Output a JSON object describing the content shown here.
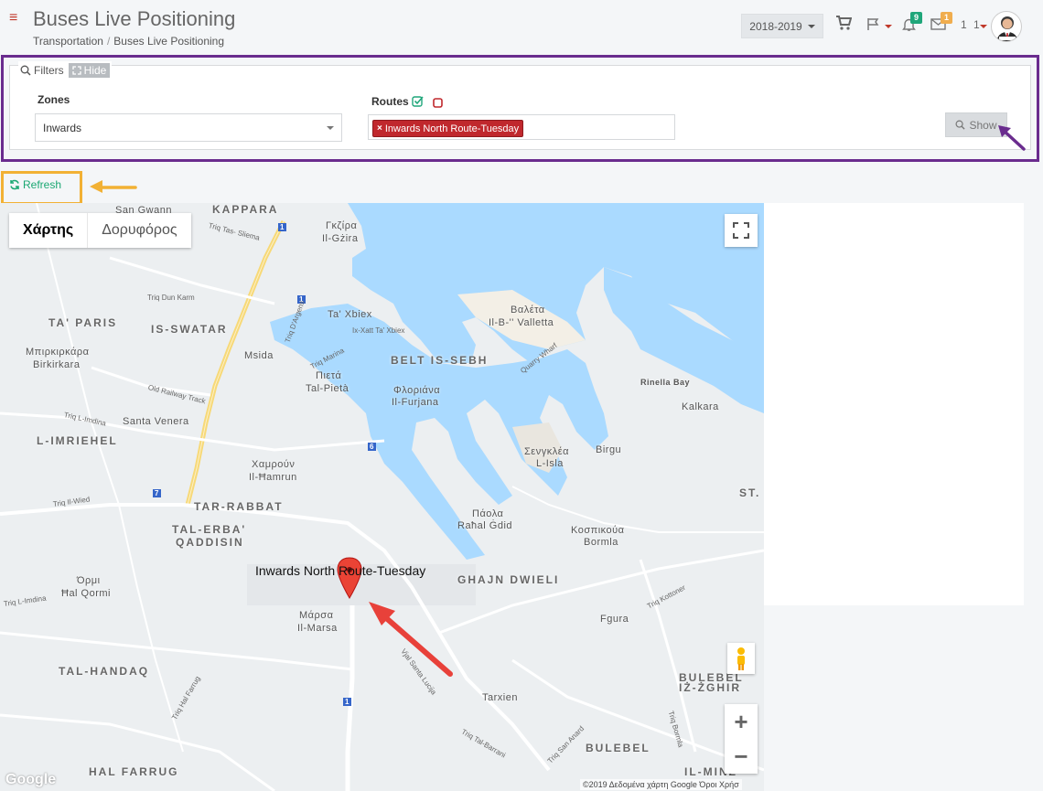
{
  "header": {
    "title": "Buses Live Positioning",
    "breadcrumb": [
      "Transportation",
      "Buses Live Positioning"
    ],
    "year_select": "2018-2019",
    "notifications_count": "9",
    "messages_count": "1",
    "user_count": "1 1",
    "colors": {
      "notif_badge": "#1fa67a",
      "msg_badge": "#f0ad4e",
      "accent": "#c0392b"
    }
  },
  "filters": {
    "legend": "Filters",
    "hide_label": "Hide",
    "zones_label": "Zones",
    "zones_value": "Inwards",
    "routes_label": "Routes",
    "route_tags": [
      "Inwards North Route-Tuesday"
    ],
    "show_label": "Show"
  },
  "refresh": {
    "label": "Refresh"
  },
  "map": {
    "map_type_options": [
      "Χάρτης",
      "Δορυφόρος"
    ],
    "selected_map_type": "Χάρτης",
    "marker_label": "Inwards North Route-Tuesday",
    "attribution": "©2019 Δεδομένα χάρτη Google    Όροι Χρήσ",
    "google_logo": "Google",
    "zoom_in": "+",
    "zoom_out": "−",
    "places": [
      {
        "id": "kappara",
        "text": "KAPPARA",
        "big": true
      },
      {
        "id": "san-gwann",
        "text": "San Gwann",
        "big": false
      },
      {
        "id": "gzira-gr",
        "text": "Γκζίρα",
        "big": false
      },
      {
        "id": "gzira",
        "text": "Il-Gżira",
        "big": false
      },
      {
        "id": "ta-paris",
        "text": "TA' PARIS",
        "big": true
      },
      {
        "id": "is-swatar",
        "text": "IS-SWATAR",
        "big": true
      },
      {
        "id": "ta-xbiex",
        "text": "Ta' Xbiex",
        "big": false
      },
      {
        "id": "valletta-gr",
        "text": "Βαλέτα",
        "big": false
      },
      {
        "id": "valletta",
        "text": "Il-B-'' Valletta",
        "big": false
      },
      {
        "id": "birkirkara-gr",
        "text": "Μπιρκιρκάρα",
        "big": false
      },
      {
        "id": "birkirkara",
        "text": "Birkirkara",
        "big": false
      },
      {
        "id": "msida",
        "text": "Msida",
        "big": false
      },
      {
        "id": "belt-is-sebh",
        "text": "BELT IS-SEBH",
        "big": true
      },
      {
        "id": "pieta-gr",
        "text": "Πιετά",
        "big": false
      },
      {
        "id": "pieta",
        "text": "Tal-Pietà",
        "big": false
      },
      {
        "id": "floriana-gr",
        "text": "Φλοριάνα",
        "big": false
      },
      {
        "id": "floriana",
        "text": "Il-Furjana",
        "big": false
      },
      {
        "id": "rinella",
        "text": "Rinella Bay",
        "big": false
      },
      {
        "id": "kalkara",
        "text": "Kalkara",
        "big": false
      },
      {
        "id": "santa-venera",
        "text": "Santa Venera",
        "big": false
      },
      {
        "id": "imriehel",
        "text": "L-IMRIEHEL",
        "big": true
      },
      {
        "id": "hamrun-gr",
        "text": "Χαμρούν",
        "big": false
      },
      {
        "id": "hamrun",
        "text": "Il-Ħamrun",
        "big": false
      },
      {
        "id": "senglea-gr",
        "text": "Σενγκλέα",
        "big": false
      },
      {
        "id": "senglea",
        "text": "L-Isla",
        "big": false
      },
      {
        "id": "birgu",
        "text": "Birgu",
        "big": false
      },
      {
        "id": "st",
        "text": "ST.",
        "big": true
      },
      {
        "id": "tar-rabbat",
        "text": "TAR-RABBAT",
        "big": true
      },
      {
        "id": "paola-gr",
        "text": "Πάολα",
        "big": false
      },
      {
        "id": "paola",
        "text": "Raħal Ġdid",
        "big": false
      },
      {
        "id": "tal-erba",
        "text": "TAL-ERBA'",
        "big": true
      },
      {
        "id": "qaddisin",
        "text": "QADDISIN",
        "big": true
      },
      {
        "id": "bormla-gr",
        "text": "Κοσπικούα",
        "big": false
      },
      {
        "id": "bormla",
        "text": "Bormla",
        "big": false
      },
      {
        "id": "qormi-gr",
        "text": "Όρμι",
        "big": false
      },
      {
        "id": "qormi",
        "text": "Ħal Qormi",
        "big": false
      },
      {
        "id": "ghajn-dwieli",
        "text": "GHAJN DWIELI",
        "big": true
      },
      {
        "id": "marsa-gr",
        "text": "Μάρσα",
        "big": false
      },
      {
        "id": "marsa",
        "text": "Il-Marsa",
        "big": false
      },
      {
        "id": "fgura",
        "text": "Fgura",
        "big": false
      },
      {
        "id": "tal-handaq",
        "text": "TAL-HANDAQ",
        "big": true
      },
      {
        "id": "bulebel-zghir",
        "text": "BULEBEL",
        "big": true
      },
      {
        "id": "iz-zghir",
        "text": "IŻ-ŻGHIR",
        "big": true
      },
      {
        "id": "tarxien",
        "text": "Tarxien",
        "big": false
      },
      {
        "id": "bulebel",
        "text": "BULEBEL",
        "big": true
      },
      {
        "id": "hal-farrug",
        "text": "HAL FARRUG",
        "big": true
      },
      {
        "id": "il-minz",
        "text": "IL-MINZ",
        "big": true
      }
    ],
    "streets": [
      {
        "id": "s1",
        "text": "Triq Tas- Sliema"
      },
      {
        "id": "s2",
        "text": "Triq Dun Karm"
      },
      {
        "id": "s3",
        "text": "Triq D'Argens"
      },
      {
        "id": "s4",
        "text": "Ix-Xatt Ta' Xbiex"
      },
      {
        "id": "s5",
        "text": "Triq Marina"
      },
      {
        "id": "s6",
        "text": "Old Railway Track"
      },
      {
        "id": "s7",
        "text": "Quarry Wharf"
      },
      {
        "id": "s8",
        "text": "Triq L-Imdina"
      },
      {
        "id": "s9",
        "text": "Triq Il-Wied"
      },
      {
        "id": "s10",
        "text": "Vjal Santa Lucija"
      },
      {
        "id": "s11",
        "text": "Triq Tal-Barrani"
      },
      {
        "id": "s12",
        "text": "Triq Hal Farrug"
      },
      {
        "id": "s13",
        "text": "Triq Kottoner"
      },
      {
        "id": "s14",
        "text": "Triq Bormla"
      },
      {
        "id": "s15",
        "text": "Triq San Anard"
      },
      {
        "id": "s16",
        "text": "Triq L-Imdina"
      }
    ],
    "road_numbers": [
      "1",
      "1",
      "6",
      "7",
      "1"
    ]
  }
}
